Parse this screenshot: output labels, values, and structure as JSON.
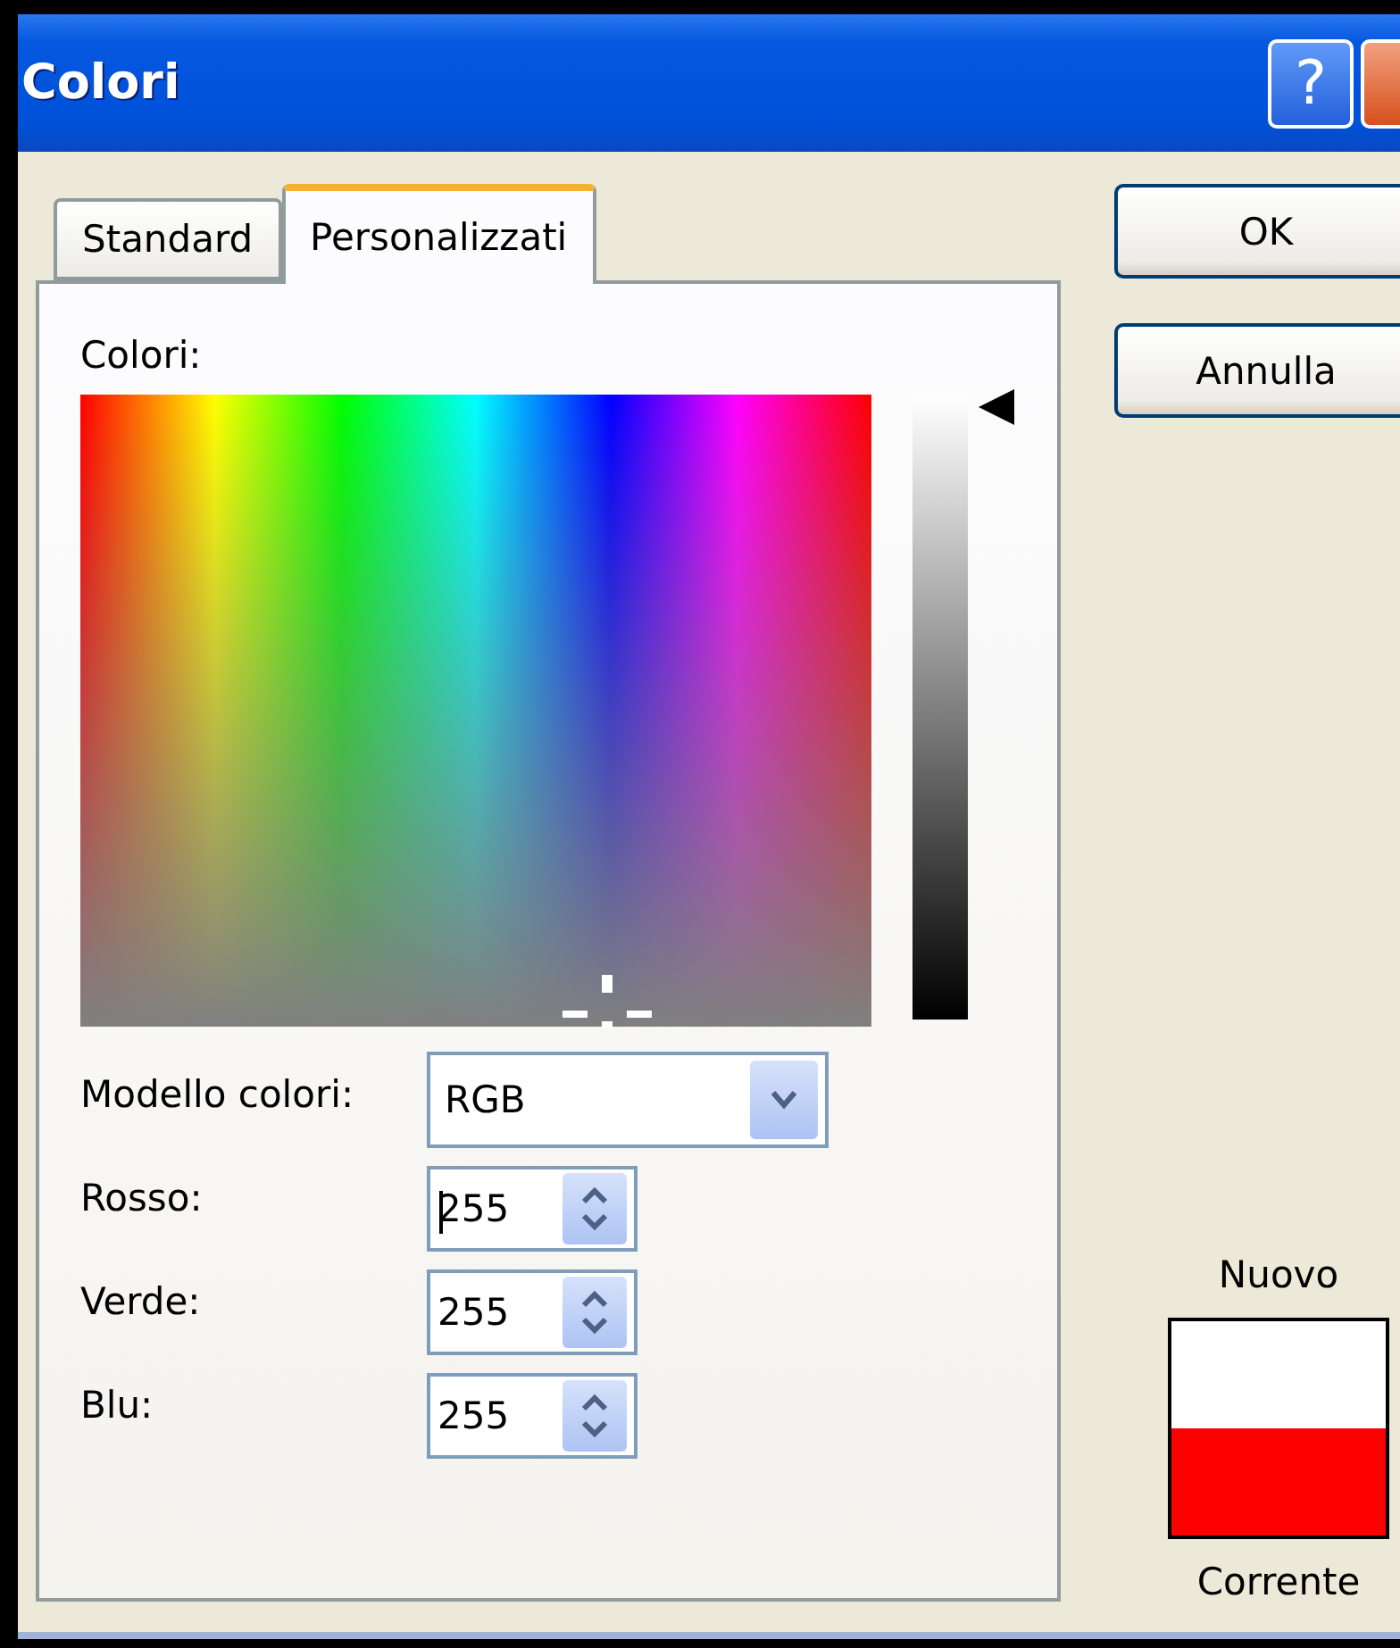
{
  "window": {
    "title": "Colori",
    "help_button": "?"
  },
  "tabs": [
    {
      "label": "Standard",
      "selected": false
    },
    {
      "label": "Personalizzati",
      "selected": true
    }
  ],
  "panel": {
    "colors_label": "Colori:",
    "luminance": {
      "level": 1
    },
    "model": {
      "label": "Modello colori:",
      "value": "RGB"
    },
    "fields": [
      {
        "label": "Rosso:",
        "value": "255",
        "focused": true
      },
      {
        "label": "Verde:",
        "value": "255",
        "focused": false
      },
      {
        "label": "Blu:",
        "value": "255",
        "focused": false
      }
    ]
  },
  "buttons": [
    "OK",
    "Annulla"
  ],
  "preview": {
    "new_label": "Nuovo",
    "current_label": "Corrente",
    "swatches": [
      {
        "color": "#ffffff"
      },
      {
        "color": "#ff0000"
      }
    ]
  }
}
